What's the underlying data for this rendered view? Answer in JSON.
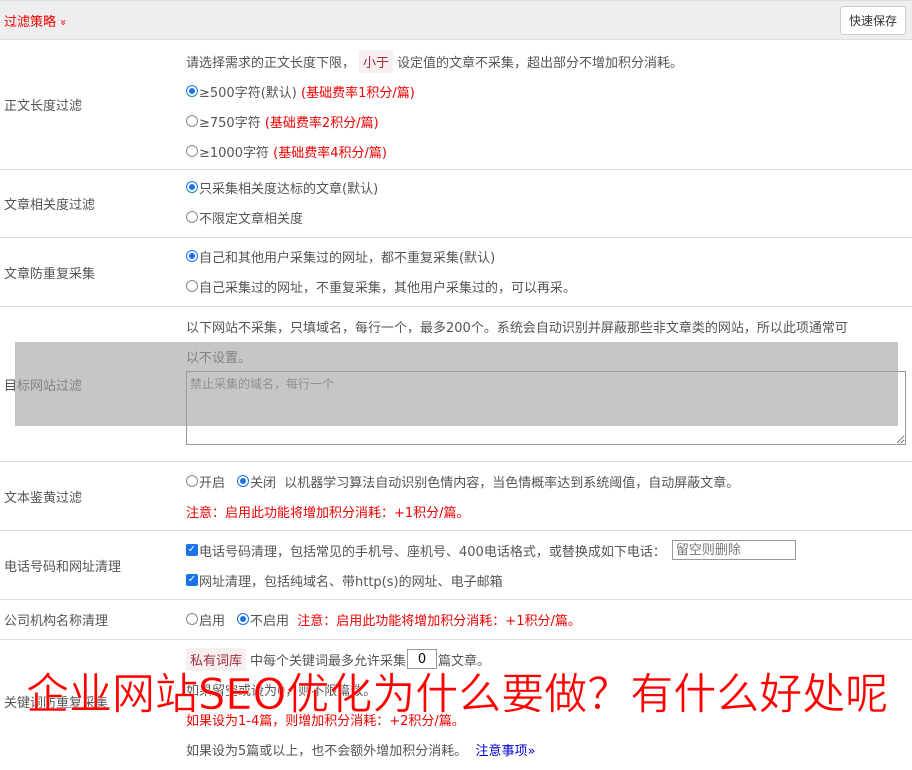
{
  "header": {
    "title": "过滤策略",
    "chevron": "»",
    "save_label": "快速保存"
  },
  "length": {
    "label": "正文长度过滤",
    "desc_pre": "请选择需求的正文长度下限，",
    "desc_tag": "小于",
    "desc_post": "设定值的文章不采集，超出部分不增加积分消耗。",
    "options": [
      {
        "text": "≥500字符(默认)",
        "note": "(基础费率1积分/篇)"
      },
      {
        "text": "≥750字符",
        "note": "(基础费率2积分/篇)"
      },
      {
        "text": "≥1000字符",
        "note": "(基础费率4积分/篇)"
      }
    ]
  },
  "relevance": {
    "label": "文章相关度过滤",
    "options": [
      "只采集相关度达标的文章(默认)",
      "不限定文章相关度"
    ]
  },
  "dedupe": {
    "label": "文章防重复采集",
    "options": [
      "自己和其他用户采集过的网址，都不重复采集(默认)",
      "自己采集过的网址，不重复采集，其他用户采集过的，可以再采。"
    ]
  },
  "site": {
    "label": "目标网站过滤",
    "desc1": "以下网站不采集，只填域名，每行一个，最多200个。系统会自动识别并屏蔽那些非文章类的网站，所以此项通常可",
    "desc2": "以不设置。",
    "placeholder": "禁止采集的域名，每行一个"
  },
  "porn": {
    "label": "文本鉴黄过滤",
    "on": "开启",
    "off": "关闭",
    "desc": "以机器学习算法自动识别色情内容，当色情概率达到系统阈值，自动屏蔽文章。",
    "note": "注意：启用此功能将增加积分消耗：+1积分/篇。"
  },
  "phone": {
    "label": "电话号码和网址清理",
    "opt1": "电话号码清理，包括常见的手机号、座机号、400电话格式，或替换成如下电话：",
    "placeholder": "留空则删除",
    "opt2": "网址清理，包括纯域名、带http(s)的网址、电子邮箱"
  },
  "company": {
    "label": "公司机构名称清理",
    "on": "启用",
    "off": "不启用",
    "note": "注意：启用此功能将增加积分消耗：+1积分/篇。"
  },
  "keyword": {
    "label": "关键词防重复采集",
    "tag": "私有词库",
    "pre": "中每个关键词最多允许采集",
    "value": "0",
    "post": "篇文章。",
    "line2": "如果留空或设为0，则不限篇数。",
    "line3": "如果设为1-4篇，则增加积分消耗：+2积分/篇。",
    "line4": "如果设为5篇或以上，也不会额外增加积分消耗。",
    "link": "注意事项»"
  },
  "banner": "企业网站SEO优化为什么要做？有什么好处呢"
}
